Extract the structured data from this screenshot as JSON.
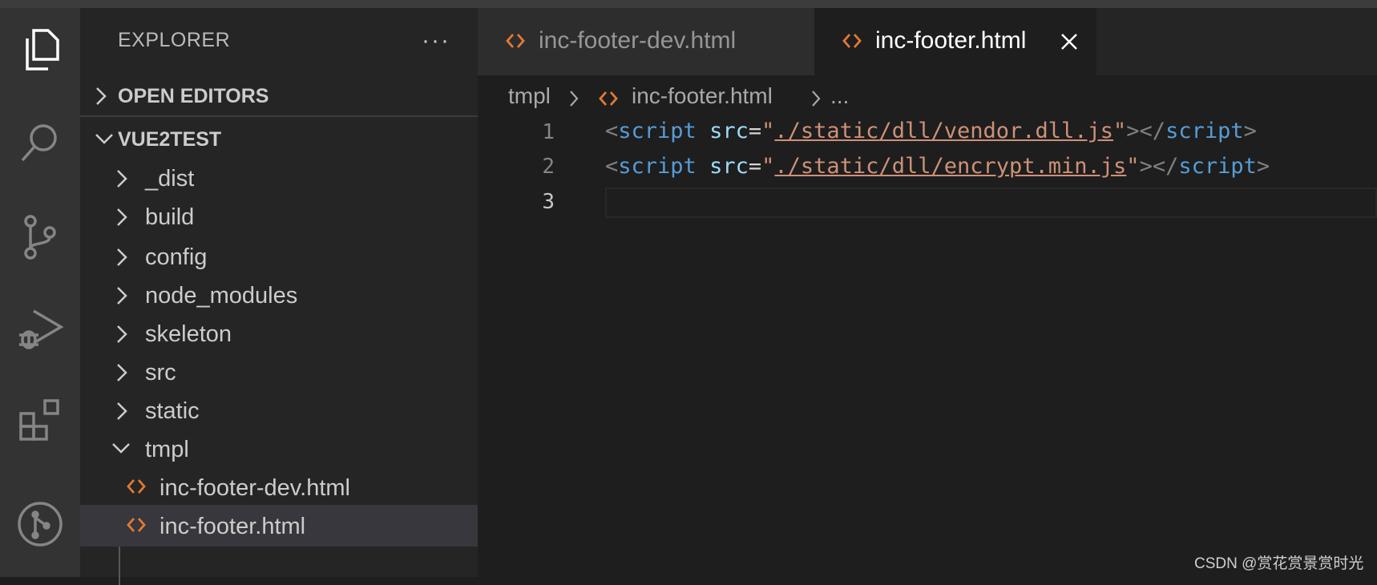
{
  "explorer": {
    "title": "EXPLORER",
    "more": "···",
    "open_editors": "OPEN EDITORS",
    "project": "VUE2TEST",
    "folders": [
      "_dist",
      "build",
      "config",
      "node_modules",
      "skeleton",
      "src",
      "static"
    ],
    "expanded_folder": "tmpl",
    "files": [
      "inc-footer-dev.html",
      "inc-footer.html"
    ],
    "selected_file": "inc-footer.html"
  },
  "tabs": [
    {
      "label": "inc-footer-dev.html",
      "active": false
    },
    {
      "label": "inc-footer.html",
      "active": true
    }
  ],
  "breadcrumb": {
    "folder": "tmpl",
    "file": "inc-footer.html",
    "tail": "..."
  },
  "editor": {
    "line_numbers": [
      "1",
      "2",
      "3"
    ],
    "lines": [
      {
        "open": "<",
        "tag": "script",
        "attr": "src",
        "eq": "=",
        "q": "\"",
        "src": "./static/dll/vendor.dll.js",
        "close": "></",
        "end": ">"
      },
      {
        "open": "<",
        "tag": "script",
        "attr": "src",
        "eq": "=",
        "q": "\"",
        "src": "./static/dll/encrypt.min.js",
        "close": "></",
        "end": ">"
      }
    ]
  },
  "watermark": "CSDN @赏花赏景赏时光",
  "colors": {
    "accent_orange": "#e37933",
    "keyword_blue": "#569cd6",
    "string_orange": "#ce9178"
  },
  "icons": {
    "activity": [
      "explorer-icon",
      "search-icon",
      "source-control-icon",
      "run-debug-icon",
      "extensions-icon",
      "git-graph-icon"
    ],
    "file": "html-file-icon"
  }
}
